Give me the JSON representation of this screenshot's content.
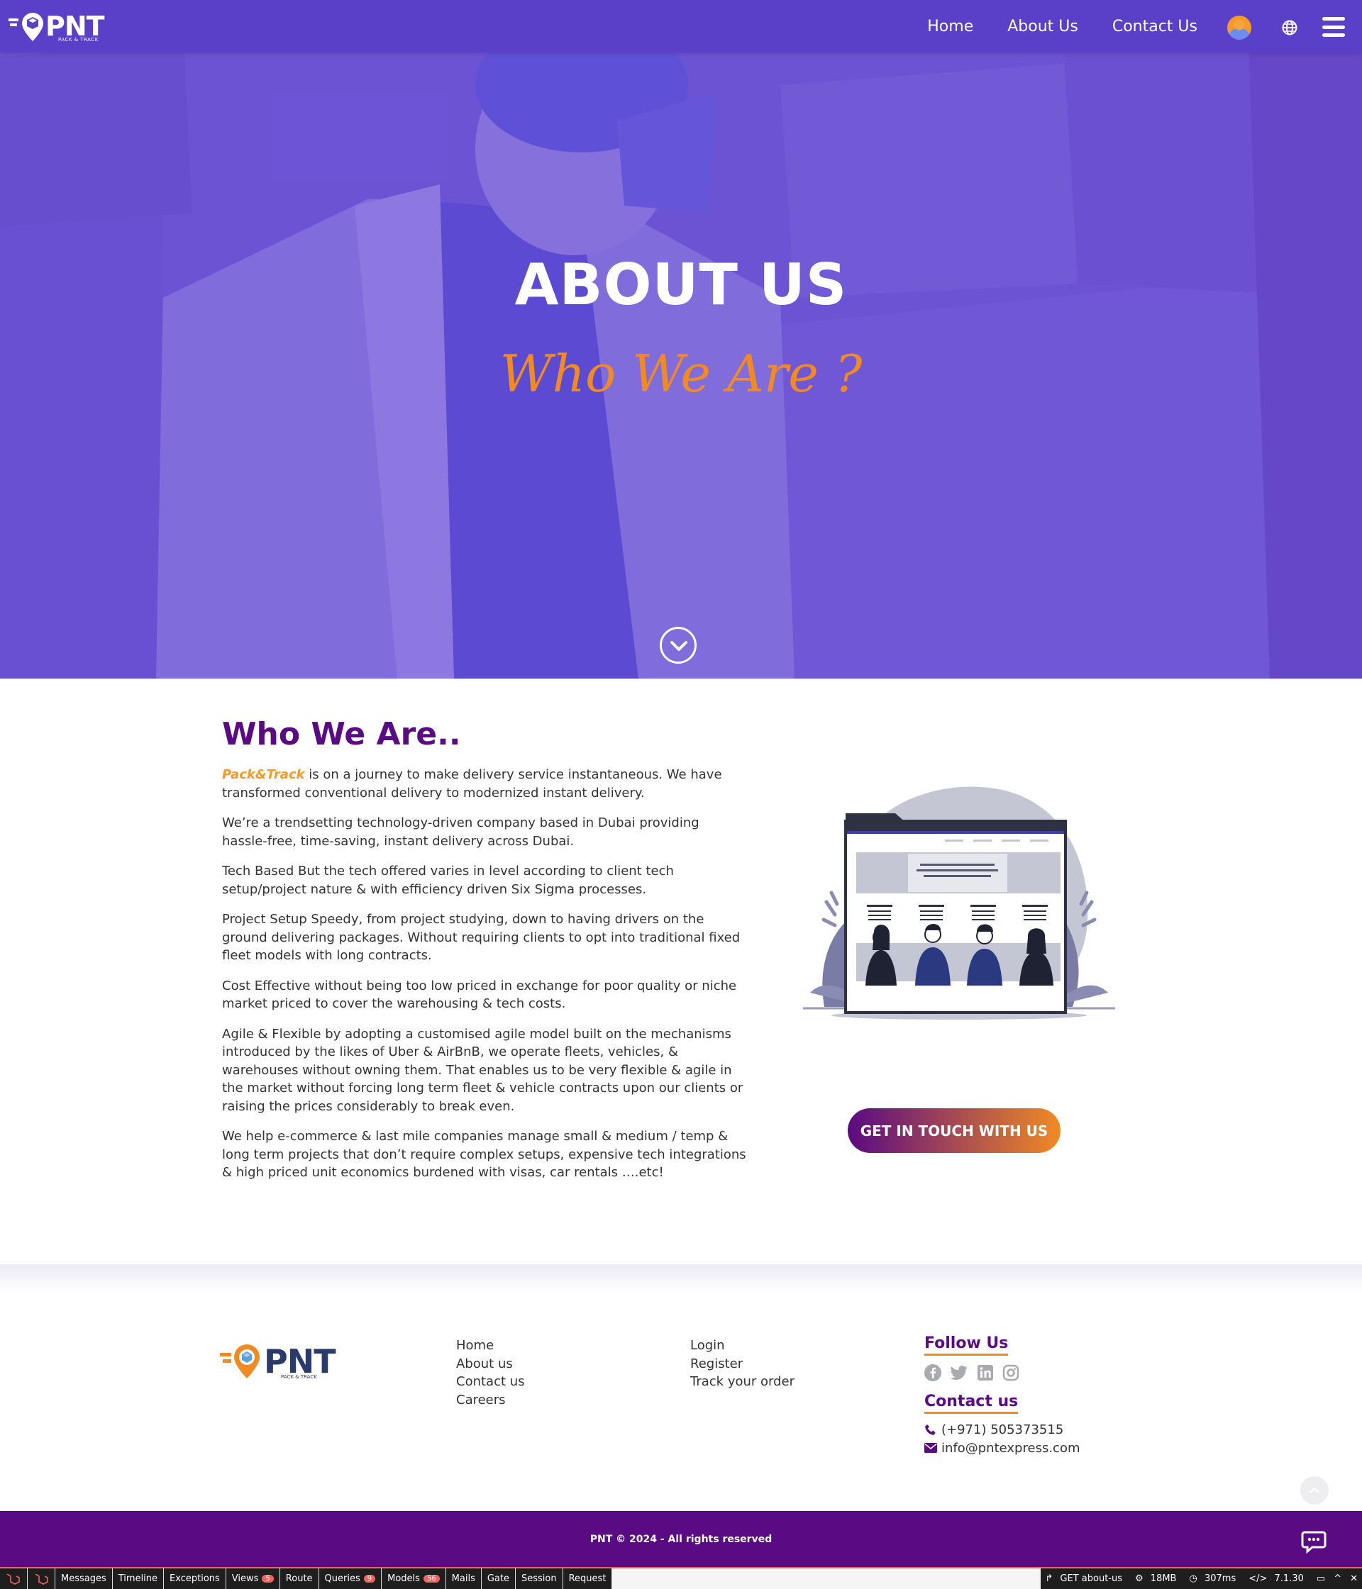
{
  "nav": {
    "logo_text": "PNT",
    "logo_sub": "PACK & TRACK",
    "links": [
      "Home",
      "About Us",
      "Contact Us"
    ]
  },
  "hero": {
    "title": "ABOUT US",
    "subtitle": "Who We Are ?"
  },
  "about": {
    "title": "Who We Are..",
    "brand": "Pack&Track",
    "p1_rest": " is on a journey to make delivery service instantaneous. We have transformed conventional delivery to modernized instant delivery.",
    "p2": "We’re a trendsetting technology-driven company based in Dubai providing hassle-free, time-saving, instant delivery across Dubai.",
    "p3": "Tech Based But the tech offered varies in level according to client tech setup/project nature & with efficiency driven Six Sigma processes.",
    "p4": "Project Setup Speedy, from project studying, down to having drivers on the ground delivering packages. Without requiring clients to opt into traditional fixed fleet models with long contracts.",
    "p5": "Cost Effective without being too low priced in exchange for poor quality or niche market priced to cover the warehousing & tech costs.",
    "p6": "Agile & Flexible by adopting a customised agile model built on the mechanisms introduced by the likes of Uber & AirBnB, we operate fleets, vehicles, & warehouses without owning them. That enables us to be very flexible & agile in the market without forcing long term fleet & vehicle contracts upon our clients or raising the prices considerably to break even.",
    "p7": "We help e-commerce & last mile companies manage small & medium / temp & long term projects that don’t require complex setups, expensive tech integrations & high priced unit economics burdened with visas, car rentals ….etc!",
    "cta": "GET IN TOUCH WITH US"
  },
  "footer": {
    "logo_text": "PNT",
    "logo_sub": "PACK & TRACK",
    "col1": [
      "Home",
      "About us",
      "Contact us",
      "Careers"
    ],
    "col2": [
      "Login",
      "Register",
      "Track your order"
    ],
    "follow_heading": "Follow Us",
    "social_icons": [
      "facebook-icon",
      "twitter-icon",
      "linkedin-icon",
      "instagram-icon"
    ],
    "contact_heading": "Contact us",
    "phone": "(+971) 505373515",
    "email": "info@pntexpress.com",
    "copyright": "PNT © 2024 - All rights reserved"
  },
  "debugbar": {
    "items": [
      "Messages",
      "Timeline",
      "Exceptions",
      "Views",
      "Route",
      "Queries",
      "Models",
      "Mails",
      "Gate",
      "Session",
      "Request"
    ],
    "views_count": "5",
    "queries_count": "9",
    "models_count": "56",
    "request": "GET about-us",
    "memory": "18MB",
    "time": "307ms",
    "version": "7.1.30"
  },
  "colors": {
    "nav_bg": "#5a3fc8",
    "brand_purple": "#5a0a82",
    "brand_orange": "#f08a24"
  }
}
